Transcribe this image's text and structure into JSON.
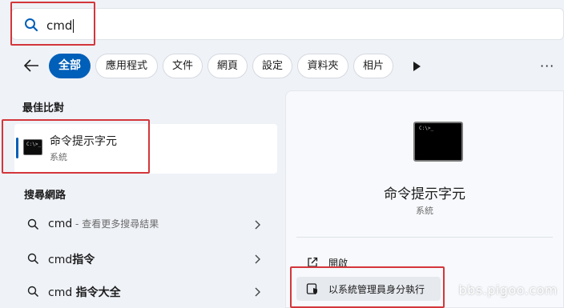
{
  "search": {
    "value": "cmd"
  },
  "filters": {
    "chips": [
      "全部",
      "應用程式",
      "文件",
      "網頁",
      "設定",
      "資料夾",
      "相片"
    ],
    "active_index": 0
  },
  "best_match": {
    "heading": "最佳比對",
    "app_name": "命令提示字元",
    "app_type": "系統"
  },
  "web_search": {
    "heading": "搜尋網路",
    "results": [
      {
        "query": "cmd",
        "hint": " - 查看更多搜尋結果"
      },
      {
        "query": "cmd",
        "bold": "指令"
      },
      {
        "query": "cmd ",
        "bold": "指令大全"
      }
    ]
  },
  "detail": {
    "app_name": "命令提示字元",
    "app_type": "系統",
    "actions": [
      "開啟",
      "以系統管理員身分執行"
    ]
  },
  "watermark": "bbs.pigoo.com",
  "colors": {
    "accent": "#005fb8",
    "highlight_box": "#d3363b"
  }
}
